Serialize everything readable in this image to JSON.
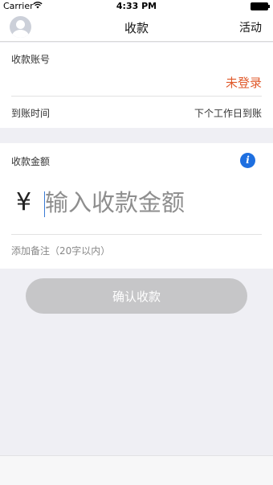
{
  "status_bar": {
    "carrier": "Carrier",
    "time": "4:33 PM"
  },
  "nav": {
    "title": "收款",
    "action_label": "活动"
  },
  "account": {
    "label": "收款账号",
    "status": "未登录",
    "status_color": "#e05a2b",
    "arrival_label": "到账时间",
    "arrival_value": "下个工作日到账"
  },
  "amount": {
    "label": "收款金额",
    "currency_symbol": "¥",
    "placeholder": "输入收款金额",
    "value": "",
    "info_icon": "i"
  },
  "note": {
    "placeholder": "添加备注（20字以内）",
    "value": ""
  },
  "confirm_button": {
    "label": "确认收款",
    "enabled": false
  },
  "colors": {
    "accent": "#1e6fe0",
    "button_disabled": "#c6c6c8"
  }
}
